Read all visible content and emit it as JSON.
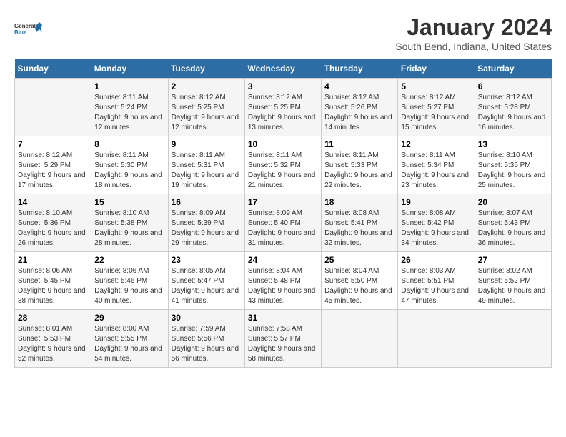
{
  "logo": {
    "line1": "General",
    "line2": "Blue"
  },
  "title": "January 2024",
  "subtitle": "South Bend, Indiana, United States",
  "days_of_week": [
    "Sunday",
    "Monday",
    "Tuesday",
    "Wednesday",
    "Thursday",
    "Friday",
    "Saturday"
  ],
  "weeks": [
    [
      {
        "day": "",
        "sunrise": "",
        "sunset": "",
        "daylight": ""
      },
      {
        "day": "1",
        "sunrise": "Sunrise: 8:11 AM",
        "sunset": "Sunset: 5:24 PM",
        "daylight": "Daylight: 9 hours and 12 minutes."
      },
      {
        "day": "2",
        "sunrise": "Sunrise: 8:12 AM",
        "sunset": "Sunset: 5:25 PM",
        "daylight": "Daylight: 9 hours and 12 minutes."
      },
      {
        "day": "3",
        "sunrise": "Sunrise: 8:12 AM",
        "sunset": "Sunset: 5:25 PM",
        "daylight": "Daylight: 9 hours and 13 minutes."
      },
      {
        "day": "4",
        "sunrise": "Sunrise: 8:12 AM",
        "sunset": "Sunset: 5:26 PM",
        "daylight": "Daylight: 9 hours and 14 minutes."
      },
      {
        "day": "5",
        "sunrise": "Sunrise: 8:12 AM",
        "sunset": "Sunset: 5:27 PM",
        "daylight": "Daylight: 9 hours and 15 minutes."
      },
      {
        "day": "6",
        "sunrise": "Sunrise: 8:12 AM",
        "sunset": "Sunset: 5:28 PM",
        "daylight": "Daylight: 9 hours and 16 minutes."
      }
    ],
    [
      {
        "day": "7",
        "sunrise": "Sunrise: 8:12 AM",
        "sunset": "Sunset: 5:29 PM",
        "daylight": "Daylight: 9 hours and 17 minutes."
      },
      {
        "day": "8",
        "sunrise": "Sunrise: 8:11 AM",
        "sunset": "Sunset: 5:30 PM",
        "daylight": "Daylight: 9 hours and 18 minutes."
      },
      {
        "day": "9",
        "sunrise": "Sunrise: 8:11 AM",
        "sunset": "Sunset: 5:31 PM",
        "daylight": "Daylight: 9 hours and 19 minutes."
      },
      {
        "day": "10",
        "sunrise": "Sunrise: 8:11 AM",
        "sunset": "Sunset: 5:32 PM",
        "daylight": "Daylight: 9 hours and 21 minutes."
      },
      {
        "day": "11",
        "sunrise": "Sunrise: 8:11 AM",
        "sunset": "Sunset: 5:33 PM",
        "daylight": "Daylight: 9 hours and 22 minutes."
      },
      {
        "day": "12",
        "sunrise": "Sunrise: 8:11 AM",
        "sunset": "Sunset: 5:34 PM",
        "daylight": "Daylight: 9 hours and 23 minutes."
      },
      {
        "day": "13",
        "sunrise": "Sunrise: 8:10 AM",
        "sunset": "Sunset: 5:35 PM",
        "daylight": "Daylight: 9 hours and 25 minutes."
      }
    ],
    [
      {
        "day": "14",
        "sunrise": "Sunrise: 8:10 AM",
        "sunset": "Sunset: 5:36 PM",
        "daylight": "Daylight: 9 hours and 26 minutes."
      },
      {
        "day": "15",
        "sunrise": "Sunrise: 8:10 AM",
        "sunset": "Sunset: 5:38 PM",
        "daylight": "Daylight: 9 hours and 28 minutes."
      },
      {
        "day": "16",
        "sunrise": "Sunrise: 8:09 AM",
        "sunset": "Sunset: 5:39 PM",
        "daylight": "Daylight: 9 hours and 29 minutes."
      },
      {
        "day": "17",
        "sunrise": "Sunrise: 8:09 AM",
        "sunset": "Sunset: 5:40 PM",
        "daylight": "Daylight: 9 hours and 31 minutes."
      },
      {
        "day": "18",
        "sunrise": "Sunrise: 8:08 AM",
        "sunset": "Sunset: 5:41 PM",
        "daylight": "Daylight: 9 hours and 32 minutes."
      },
      {
        "day": "19",
        "sunrise": "Sunrise: 8:08 AM",
        "sunset": "Sunset: 5:42 PM",
        "daylight": "Daylight: 9 hours and 34 minutes."
      },
      {
        "day": "20",
        "sunrise": "Sunrise: 8:07 AM",
        "sunset": "Sunset: 5:43 PM",
        "daylight": "Daylight: 9 hours and 36 minutes."
      }
    ],
    [
      {
        "day": "21",
        "sunrise": "Sunrise: 8:06 AM",
        "sunset": "Sunset: 5:45 PM",
        "daylight": "Daylight: 9 hours and 38 minutes."
      },
      {
        "day": "22",
        "sunrise": "Sunrise: 8:06 AM",
        "sunset": "Sunset: 5:46 PM",
        "daylight": "Daylight: 9 hours and 40 minutes."
      },
      {
        "day": "23",
        "sunrise": "Sunrise: 8:05 AM",
        "sunset": "Sunset: 5:47 PM",
        "daylight": "Daylight: 9 hours and 41 minutes."
      },
      {
        "day": "24",
        "sunrise": "Sunrise: 8:04 AM",
        "sunset": "Sunset: 5:48 PM",
        "daylight": "Daylight: 9 hours and 43 minutes."
      },
      {
        "day": "25",
        "sunrise": "Sunrise: 8:04 AM",
        "sunset": "Sunset: 5:50 PM",
        "daylight": "Daylight: 9 hours and 45 minutes."
      },
      {
        "day": "26",
        "sunrise": "Sunrise: 8:03 AM",
        "sunset": "Sunset: 5:51 PM",
        "daylight": "Daylight: 9 hours and 47 minutes."
      },
      {
        "day": "27",
        "sunrise": "Sunrise: 8:02 AM",
        "sunset": "Sunset: 5:52 PM",
        "daylight": "Daylight: 9 hours and 49 minutes."
      }
    ],
    [
      {
        "day": "28",
        "sunrise": "Sunrise: 8:01 AM",
        "sunset": "Sunset: 5:53 PM",
        "daylight": "Daylight: 9 hours and 52 minutes."
      },
      {
        "day": "29",
        "sunrise": "Sunrise: 8:00 AM",
        "sunset": "Sunset: 5:55 PM",
        "daylight": "Daylight: 9 hours and 54 minutes."
      },
      {
        "day": "30",
        "sunrise": "Sunrise: 7:59 AM",
        "sunset": "Sunset: 5:56 PM",
        "daylight": "Daylight: 9 hours and 56 minutes."
      },
      {
        "day": "31",
        "sunrise": "Sunrise: 7:58 AM",
        "sunset": "Sunset: 5:57 PM",
        "daylight": "Daylight: 9 hours and 58 minutes."
      },
      {
        "day": "",
        "sunrise": "",
        "sunset": "",
        "daylight": ""
      },
      {
        "day": "",
        "sunrise": "",
        "sunset": "",
        "daylight": ""
      },
      {
        "day": "",
        "sunrise": "",
        "sunset": "",
        "daylight": ""
      }
    ]
  ]
}
